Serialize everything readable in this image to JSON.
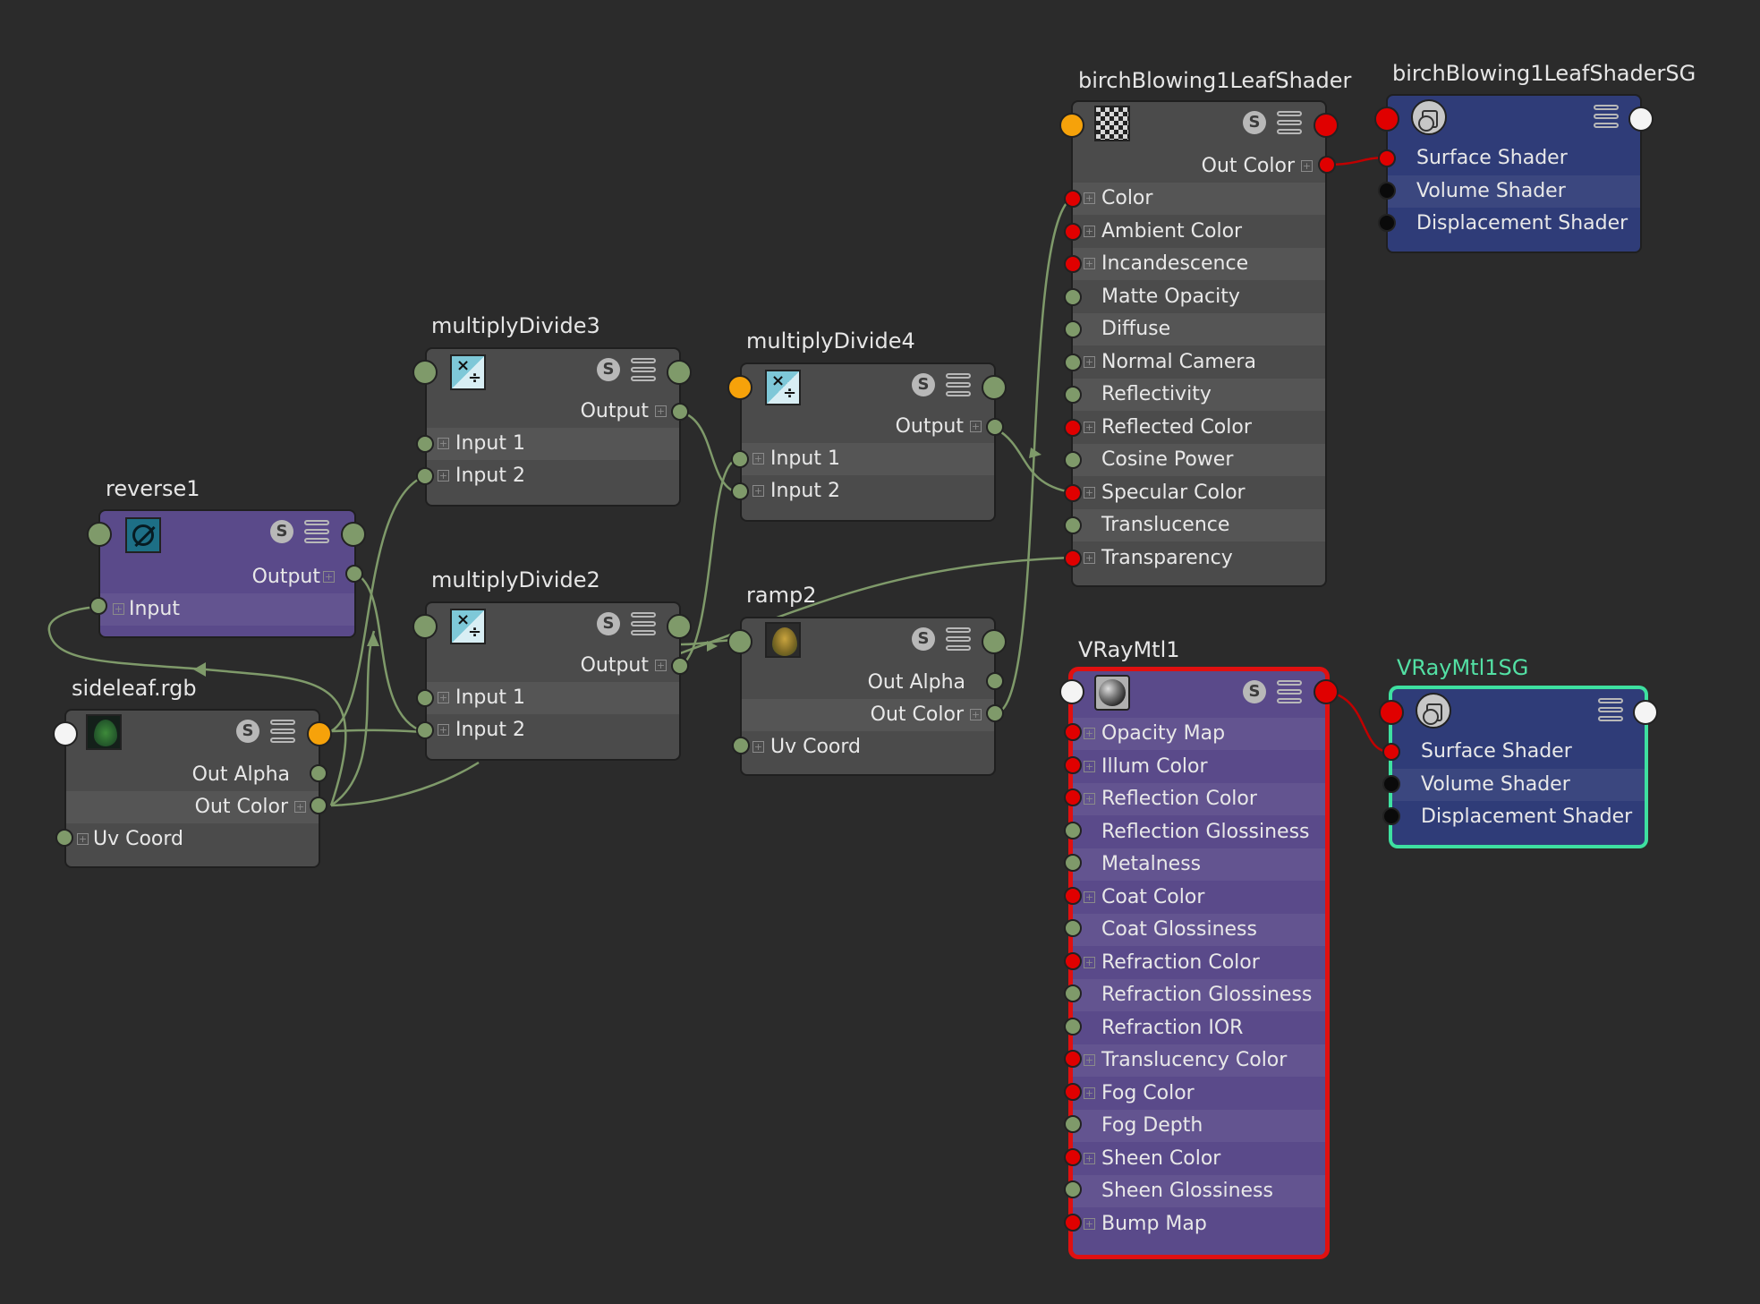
{
  "colors": {
    "background": "#2b2b2b",
    "wire": "#7f9a6a",
    "wire_red": "#c00000",
    "port_green": "#7f9a6a",
    "port_red": "#e00000",
    "port_orange": "#f6a20a",
    "selection_red": "#e01010",
    "selection_green": "#3ee0a0"
  },
  "nodes": {
    "reverse1": {
      "title": "reverse1",
      "icon": "reverse-icon",
      "output": "Output",
      "input": "Input"
    },
    "sideleaf": {
      "title": "sideleaf.rgb",
      "icon": "leaf-texture-icon",
      "out_alpha": "Out Alpha",
      "out_color": "Out Color",
      "uv_coord": "Uv Coord"
    },
    "md3": {
      "title": "multiplyDivide3",
      "icon": "multiply-divide-icon",
      "output": "Output",
      "input1": "Input 1",
      "input2": "Input 2"
    },
    "md2": {
      "title": "multiplyDivide2",
      "icon": "multiply-divide-icon",
      "output": "Output",
      "input1": "Input 1",
      "input2": "Input 2"
    },
    "md4": {
      "title": "multiplyDivide4",
      "icon": "multiply-divide-icon",
      "output": "Output",
      "input1": "Input 1",
      "input2": "Input 2"
    },
    "ramp2": {
      "title": "ramp2",
      "icon": "ramp-texture-icon",
      "out_alpha": "Out Alpha",
      "out_color": "Out Color",
      "uv_coord": "Uv Coord"
    },
    "birch": {
      "title": "birchBlowing1LeafShader",
      "icon": "checker-icon",
      "out_color": "Out Color",
      "attrs": [
        "Color",
        "Ambient Color",
        "Incandescence",
        "Matte Opacity",
        "Diffuse",
        "Normal Camera",
        "Reflectivity",
        "Reflected Color",
        "Cosine Power",
        "Specular Color",
        "Translucence",
        "Transparency"
      ]
    },
    "birch_sg": {
      "title": "birchBlowing1LeafShaderSG",
      "icon": "shading-group-icon",
      "attrs": [
        "Surface Shader",
        "Volume Shader",
        "Displacement Shader"
      ]
    },
    "vray": {
      "title": "VRayMtl1",
      "icon": "sphere-material-icon",
      "attrs": [
        "Opacity Map",
        "Illum Color",
        "Reflection Color",
        "Reflection Glossiness",
        "Metalness",
        "Coat Color",
        "Coat Glossiness",
        "Refraction Color",
        "Refraction Glossiness",
        "Refraction IOR",
        "Translucency Color",
        "Fog Color",
        "Fog Depth",
        "Sheen Color",
        "Sheen Glossiness",
        "Bump Map"
      ]
    },
    "vray_sg": {
      "title": "VRayMtl1SG",
      "icon": "shading-group-icon",
      "attrs": [
        "Surface Shader",
        "Volume Shader",
        "Displacement Shader"
      ]
    }
  },
  "solo_label": "S"
}
